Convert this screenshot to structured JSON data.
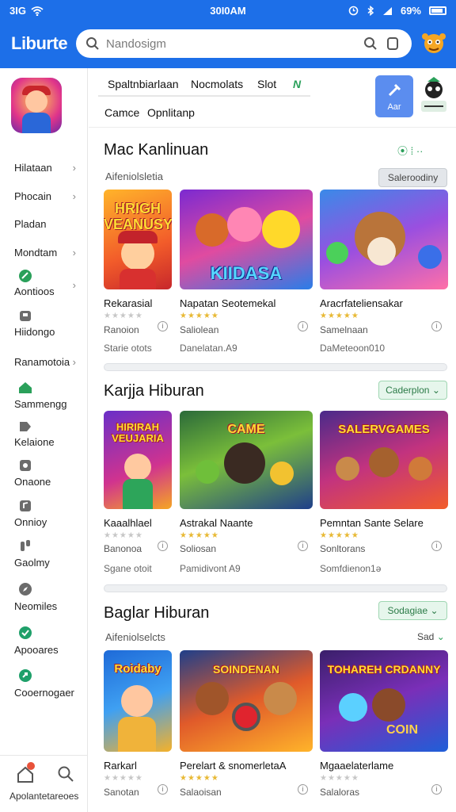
{
  "status": {
    "left": "3IG",
    "time": "30I0AM",
    "battery": "69%"
  },
  "header": {
    "brand": "Liburte",
    "search_placeholder": "Nandosigm"
  },
  "sidebar": {
    "items": [
      {
        "label": "Hilataan",
        "chevron": true
      },
      {
        "label": "Phocain",
        "chevron": true
      },
      {
        "label": "Pladan",
        "chevron": false
      },
      {
        "label": "Mondtam",
        "chevron": true
      },
      {
        "label": "Aontioos",
        "chevron": true
      },
      {
        "label": "Hiidongo",
        "chevron": false
      },
      {
        "label": "Ranamotoia",
        "chevron": true
      },
      {
        "label": "Sammengg",
        "chevron": false
      },
      {
        "label": "Kelaione",
        "chevron": false
      },
      {
        "label": "Onaone",
        "chevron": false
      },
      {
        "label": "Onnioy",
        "chevron": false
      },
      {
        "label": "Gaolmy",
        "chevron": false
      },
      {
        "label": "Neomiles",
        "chevron": false
      },
      {
        "label": "Apooares",
        "chevron": false
      },
      {
        "label": "Cooernogaer",
        "chevron": false
      }
    ],
    "bottom_label": "Apolantetareoes"
  },
  "tabs": {
    "row1": [
      "Spaltnbiarlaan",
      "Nocmolats",
      "Slot"
    ],
    "row1_extra": "N",
    "row2": [
      "Camce",
      "Opnlitanp"
    ],
    "feature_label": "Aar"
  },
  "sections": [
    {
      "title": "Mac Kanlinuan",
      "subtitle": "Aifeniolsletia",
      "filter": "Saleroodiny",
      "header_extra": "⦿ ⁞ ··",
      "cards": [
        {
          "thumb_text": "HRIGH VEANUSY",
          "title": "Rekarasial",
          "stars": "★★★★★",
          "stars_filled": false,
          "rating": "Ranoion",
          "meta": "Starie otots"
        },
        {
          "thumb_text": "KIIDASA",
          "title": "Napatan Seotemekal",
          "stars": "★★★★★",
          "stars_filled": true,
          "rating": "Saliolean",
          "meta": "Danelatan.A9"
        },
        {
          "thumb_text": "",
          "title": "Aracrfateliensakar",
          "stars": "★★★★★",
          "stars_filled": true,
          "rating": "Samelnaan",
          "meta": "DaMeteoon010"
        }
      ]
    },
    {
      "title": "Karjja Hiburan",
      "subtitle": "",
      "filter": "Caderplon",
      "header_extra": "",
      "cards": [
        {
          "thumb_text": "HIRIRAH VEUJARIA",
          "title": "Kaaalhlael",
          "stars": "★★★★★",
          "stars_filled": false,
          "rating": "Banonoa",
          "meta": "Sgane otoit"
        },
        {
          "thumb_text": "CAME",
          "title": "Astrakal Naante",
          "stars": "★★★★★",
          "stars_filled": true,
          "rating": "Soliosan",
          "meta": "Pamidivont A9"
        },
        {
          "thumb_text": "SALERVGAMES",
          "title": "Pemntan Sante Selare",
          "stars": "★★★★★",
          "stars_filled": true,
          "rating": "Sonltorans",
          "meta": "Somfdienon1ə"
        }
      ]
    },
    {
      "title": "Baglar Hiburan",
      "subtitle": "Aifeniolselcts",
      "filter": "Sodagiae",
      "header_extra": "Sad",
      "cards": [
        {
          "thumb_text": "Roidaby",
          "title": "Rarkarl",
          "stars": "★★★★★",
          "stars_filled": false,
          "rating": "Sanotan",
          "meta": ""
        },
        {
          "thumb_text": "SOINDENAN",
          "title": "Perelart & snomerletaA",
          "stars": "★★★★★",
          "stars_filled": true,
          "rating": "Salaoisan",
          "meta": ""
        },
        {
          "thumb_text": "TOHAREH CRDANNY",
          "title": "Mgaaelaterlame",
          "stars": "★★★★★",
          "stars_filled": false,
          "rating": "Salaloras",
          "meta": ""
        }
      ]
    }
  ],
  "colors": {
    "topbar": "#1d6fe8",
    "accent_green": "#2aa05a",
    "star": "#e8b935"
  }
}
